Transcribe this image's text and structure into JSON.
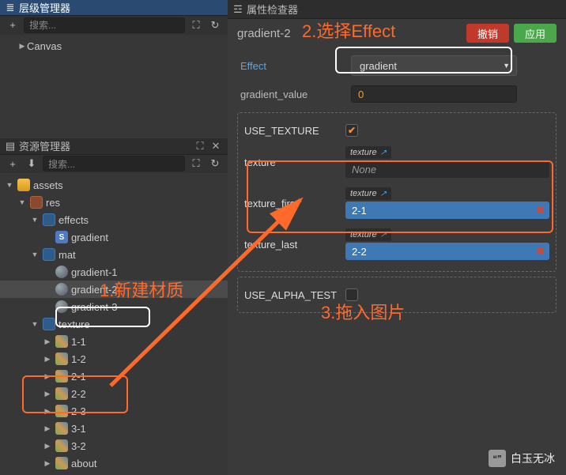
{
  "top_panel": {
    "title": "层级管理器",
    "search_placeholder": "搜索...",
    "canvas": "Canvas"
  },
  "assets_panel": {
    "title": "资源管理器",
    "search_placeholder": "搜索...",
    "tree": {
      "root": "assets",
      "res": "res",
      "effects": "effects",
      "gradient_shader": "gradient",
      "mat": "mat",
      "mat1": "gradient-1",
      "mat2": "gradient-2",
      "mat3": "gradient-3",
      "texture": "texture",
      "t11": "1-1",
      "t12": "1-2",
      "t21": "2-1",
      "t22": "2-2",
      "t23": "2-3",
      "t31": "3-1",
      "t32": "3-2",
      "about": "about"
    }
  },
  "inspector": {
    "panel_title": "属性检查器",
    "title": "gradient-2",
    "undo": "撤销",
    "apply": "应用",
    "effect_label": "Effect",
    "effect_value": "gradient",
    "gradient_value_label": "gradient_value",
    "gradient_value": "0",
    "use_texture_label": "USE_TEXTURE",
    "texture_tag": "texture",
    "prop_texture": "texture",
    "prop_texture_val": "None",
    "prop_first": "texture_first",
    "prop_first_val": "2-1",
    "prop_last": "texture_last",
    "prop_last_val": "2-2",
    "use_alpha_label": "USE_ALPHA_TEST"
  },
  "annotations": {
    "a1": "1.新建材质",
    "a2": "2.选择Effect",
    "a3": "3.拖入图片"
  },
  "watermark": "白玉无冰"
}
